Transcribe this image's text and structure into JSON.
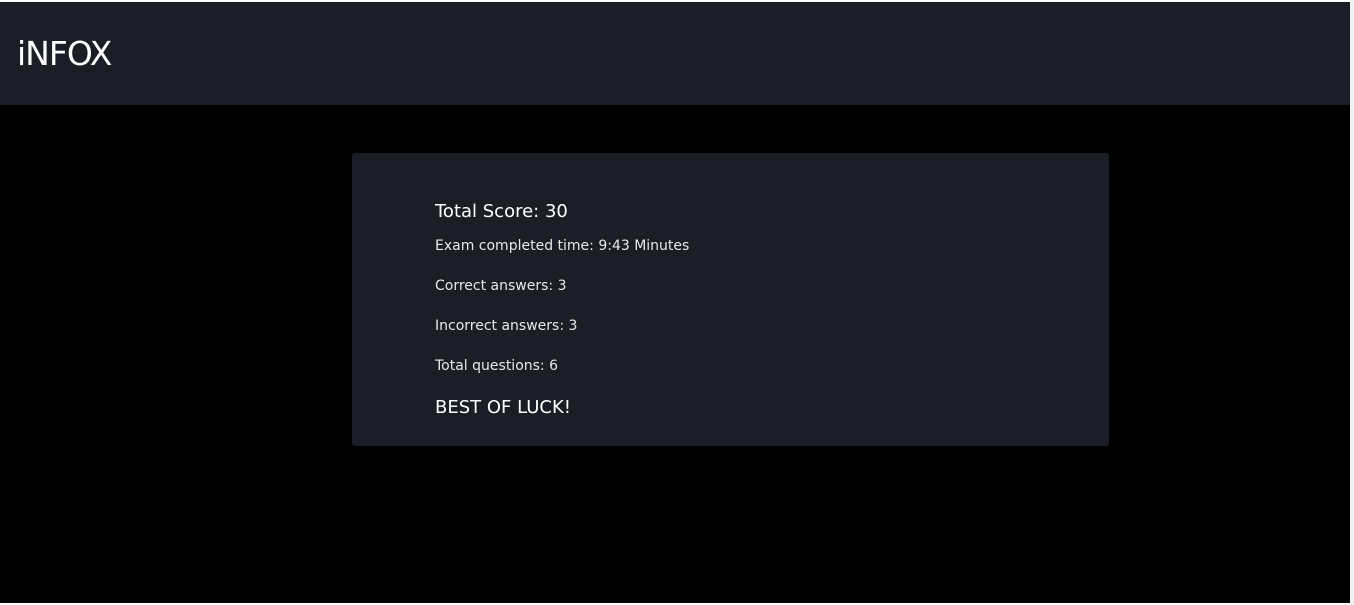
{
  "header": {
    "brand": "iNFOX"
  },
  "result": {
    "total_score": "Total Score: 30",
    "completed_time": "Exam completed time: 9:43 Minutes",
    "correct_answers": "Correct answers: 3",
    "incorrect_answers": "Incorrect answers: 3",
    "total_questions": "Total questions: 6",
    "closing_message": "BEST OF LUCK!"
  },
  "colors": {
    "page_background": "#000000",
    "panel_background": "#1b1e26",
    "text": "#ffffff"
  }
}
